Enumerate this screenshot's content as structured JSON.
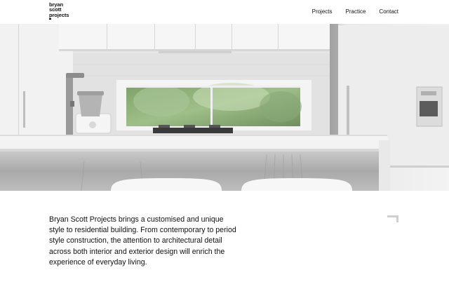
{
  "brand": {
    "logo_lines": [
      "bryan",
      "scott",
      "projects"
    ]
  },
  "nav": {
    "items": [
      "Projects",
      "Practice",
      "Contact"
    ]
  },
  "hero": {
    "alt": "Kitchen interior"
  },
  "intro": {
    "lines": [
      "Bryan Scott Projects brings a customised and unique",
      "style to residential building. From contemporary to period",
      "style construction, the attention to architectural detail",
      "across both interior and exterior design will enrich the",
      "experience of everyday living."
    ]
  },
  "colors": {
    "text": "#111111",
    "background": "#ffffff",
    "accent_grey": "#cfcfcf"
  },
  "icons": [
    "corner-bracket-icon"
  ]
}
